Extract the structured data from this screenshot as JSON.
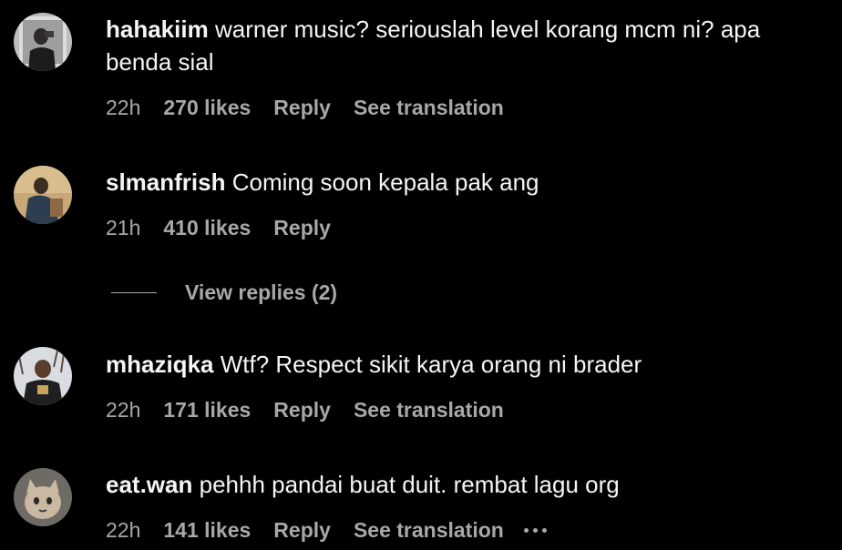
{
  "comments": [
    {
      "username": "hahakiim",
      "text": "warner music? seriouslah level korang mcm ni? apa benda sial",
      "time": "22h",
      "likes": "270 likes",
      "reply": "Reply",
      "translate": "See translation"
    },
    {
      "username": "slmanfrish",
      "text": "Coming soon kepala pak ang",
      "time": "21h",
      "likes": "410 likes",
      "reply": "Reply",
      "view_replies": "View replies (2)"
    },
    {
      "username": "mhaziqka",
      "text": "Wtf? Respect sikit karya orang ni brader",
      "time": "22h",
      "likes": "171 likes",
      "reply": "Reply",
      "translate": "See translation"
    },
    {
      "username": "eat.wan",
      "text": "pehhh pandai buat duit. rembat lagu org",
      "time": "22h",
      "likes": "141 likes",
      "reply": "Reply",
      "translate": "See translation",
      "more_icon": "more-options-icon"
    }
  ],
  "colors": {
    "background": "#000000",
    "primary_text": "#f5f5f5",
    "secondary_text": "#a8a8a8"
  }
}
